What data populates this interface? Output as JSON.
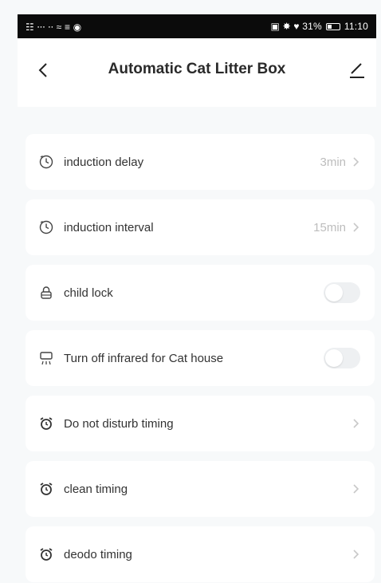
{
  "status_bar": {
    "left_text": "☷ ⸱⸱⸱ ⸱⸱ ≈ ≡ ◉",
    "right_text": "▣ ✸ ♥ 31%",
    "time": "11:10",
    "battery_percent": 31
  },
  "header": {
    "title": "Automatic Cat Litter Box",
    "back_icon": "chevron-left-icon",
    "edit_icon": "pencil-icon"
  },
  "settings": {
    "induction_delay": {
      "label": "induction delay",
      "value": "3min"
    },
    "induction_interval": {
      "label": "induction interval",
      "value": "15min"
    },
    "child_lock": {
      "label": "child lock",
      "enabled": false
    },
    "infrared": {
      "label": "Turn off infrared for Cat house",
      "enabled": false
    },
    "do_not_disturb": {
      "label": "Do not disturb timing"
    },
    "clean_timing": {
      "label": "clean timing"
    },
    "deodo_timing": {
      "label": "deodo timing"
    }
  },
  "colors": {
    "background": "#f7f9fa",
    "card": "#ffffff",
    "value_text": "#bdbdbd",
    "toggle_off": "#eef0f2"
  }
}
